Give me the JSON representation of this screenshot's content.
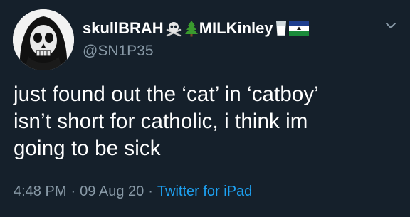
{
  "colors": {
    "background": "#15202b",
    "text": "#ffffff",
    "muted": "#8899a6",
    "accent": "#1da1f2"
  },
  "user": {
    "avatar_icon": "skull-hood-avatar",
    "display_name_part1": "skullBRAH",
    "emoji1_icon": "skull-crossbones-icon",
    "emoji2_icon": "evergreen-tree-icon",
    "display_name_part2": "MILKinley",
    "emoji3_icon": "glass-of-milk-icon",
    "emoji4_icon": "lesotho-flag-icon",
    "handle": "@SN1P35"
  },
  "menu": {
    "icon": "chevron-down-icon"
  },
  "tweet": {
    "lines": [
      "just found out the ‘cat’ in ‘catboy’",
      "isn’t short for catholic, i think im",
      "going to be sick"
    ],
    "time": "4:48 PM",
    "separator": "·",
    "date": "09 Aug 20",
    "source": "Twitter for iPad"
  }
}
